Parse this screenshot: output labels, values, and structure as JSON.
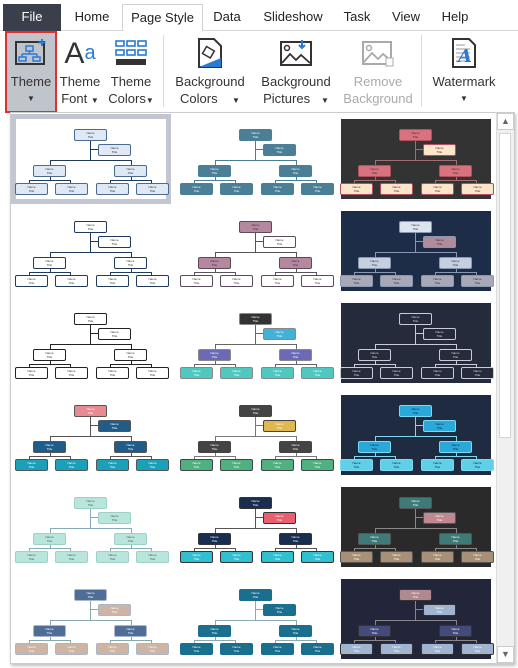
{
  "tabs": [
    {
      "label": "File"
    },
    {
      "label": "Home"
    },
    {
      "label": "Page Style",
      "active": true
    },
    {
      "label": "Data"
    },
    {
      "label": "Slideshow"
    },
    {
      "label": "Task"
    },
    {
      "label": "View"
    },
    {
      "label": "Help"
    }
  ],
  "ribbon": {
    "theme": {
      "line1": "Theme",
      "line2": "",
      "icon": "theme-org-chart-icon",
      "selected": true
    },
    "theme_font": {
      "line1": "Theme",
      "line2": "Font",
      "icon": "font-Aa-icon"
    },
    "theme_colors": {
      "line1": "Theme",
      "line2": "Colors",
      "icon": "color-grid-icon"
    },
    "bg_colors": {
      "line1": "Background",
      "line2": "Colors",
      "icon": "paint-bucket-icon"
    },
    "bg_pictures": {
      "line1": "Background",
      "line2": "Pictures",
      "icon": "picture-icon"
    },
    "remove_bg": {
      "line1": "Remove",
      "line2": "Background",
      "icon": "picture-delete-icon",
      "disabled": true
    },
    "watermark": {
      "line1": "Watermark",
      "line2": "",
      "icon": "watermark-icon"
    }
  },
  "node_text": {
    "name": "Name",
    "title": "Title"
  },
  "themes": [
    {
      "bg": "#ffffff",
      "top": "#dfe9f5",
      "asst": "#dfe9f5",
      "mid": "#dfe9f5",
      "leaf": "#dfe9f5",
      "border": "#4a6a90",
      "line": "#1f3a5a",
      "text": "#333",
      "selected": true
    },
    {
      "bg": "#ffffff",
      "top": "#4a7f96",
      "asst": "#4a7f96",
      "mid": "#4a7f96",
      "leaf": "#4a7f96",
      "border": "#4a7f96",
      "line": "#4a7f96",
      "text": "#fff"
    },
    {
      "bg": "#333333",
      "top": "#d9727f",
      "asst": "#fde5cc",
      "mid": "#d9727f",
      "leaf": "#fde5cc",
      "border": "#b05060",
      "line": "#a07070",
      "text": "#333"
    },
    {
      "bg": "#ffffff",
      "top": "#ffffff",
      "asst": "#ffffff",
      "mid": "#ffffff",
      "leaf": "#ffffff",
      "border": "#1f3a5a",
      "line": "#1f3a5a",
      "text": "#333"
    },
    {
      "bg": "#ffffff",
      "top": "#b5889f",
      "asst": "#ffffff",
      "mid": "#b5889f",
      "leaf": "#ffffff",
      "border": "#5a4a5a",
      "line": "#555",
      "text": "#333"
    },
    {
      "bg": "#1e2d47",
      "top": "#dbe5f0",
      "asst": "#b08b9b",
      "mid": "#c5cfe0",
      "leaf": "#a8a8b8",
      "border": "#8898b0",
      "line": "#8898b0",
      "text": "#333"
    },
    {
      "bg": "#ffffff",
      "top": "#ffffff",
      "asst": "#ffffff",
      "mid": "#ffffff",
      "leaf": "#ffffff",
      "border": "#222",
      "line": "#222",
      "text": "#333"
    },
    {
      "bg": "#ffffff",
      "top": "#333333",
      "asst": "#45b0d8",
      "mid": "#6b6bb5",
      "leaf": "#4fc9c0",
      "border": "#888",
      "line": "#666",
      "text": "#fff"
    },
    {
      "bg": "#262b3c",
      "top": "#262b3c",
      "asst": "#262b3c",
      "mid": "#262b3c",
      "leaf": "#262b3c",
      "border": "#c8ccd8",
      "line": "#c8ccd8",
      "text": "#ddd"
    },
    {
      "bg": "#ffffff",
      "top": "#e88a92",
      "asst": "#1f5c8a",
      "mid": "#1f5c8a",
      "leaf": "#1aa0b8",
      "border": "#555",
      "line": "#555",
      "text": "#fff"
    },
    {
      "bg": "#ffffff",
      "top": "#444444",
      "asst": "#e0b850",
      "mid": "#444444",
      "leaf": "#4fb080",
      "border": "#444",
      "line": "#777",
      "text": "#fff"
    },
    {
      "bg": "#1e2b40",
      "top": "#2aa8d8",
      "asst": "#2aa8d8",
      "mid": "#2aa8d8",
      "leaf": "#5fd0e8",
      "border": "#7fd8f0",
      "line": "#7fd8f0",
      "text": "#123"
    },
    {
      "bg": "#ffffff",
      "top": "#b8e6dc",
      "asst": "#b8e6dc",
      "mid": "#b8e6dc",
      "leaf": "#b8e6dc",
      "border": "#9fd0c6",
      "line": "#8ab",
      "text": "#555"
    },
    {
      "bg": "#ffffff",
      "top": "#1a2e50",
      "asst": "#e86070",
      "mid": "#1a2e50",
      "leaf": "#30c0d0",
      "border": "#333",
      "line": "#555",
      "text": "#fff"
    },
    {
      "bg": "#2a2a2a",
      "top": "#3e7a78",
      "asst": "#c08890",
      "mid": "#3e7a78",
      "leaf": "#a89078",
      "border": "#555",
      "line": "#888",
      "text": "#fff"
    },
    {
      "bg": "#ffffff",
      "top": "#4f6d95",
      "asst": "#ceb4a4",
      "mid": "#4f6d95",
      "leaf": "#ceb4a4",
      "border": "#a8b8c8",
      "line": "#8aa",
      "text": "#fff"
    },
    {
      "bg": "#ffffff",
      "top": "#1a6e8e",
      "asst": "#1a6e8e",
      "mid": "#1a6e8e",
      "leaf": "#1a6e8e",
      "border": "#1a6e8e",
      "line": "#8ab",
      "text": "#ffe"
    },
    {
      "bg": "#23263a",
      "top": "#b08890",
      "asst": "#a0b4d0",
      "mid": "#444a7a",
      "leaf": "#a0b4d0",
      "border": "#333",
      "line": "#888",
      "text": "#fff"
    }
  ]
}
